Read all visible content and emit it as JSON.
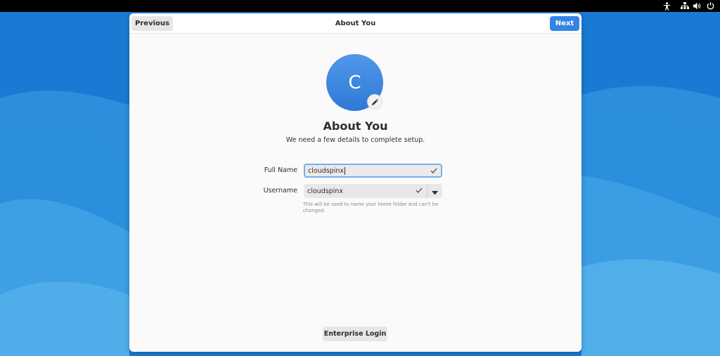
{
  "topbar": {
    "icons": [
      "accessibility-icon",
      "network-wired-icon",
      "volume-icon",
      "power-icon"
    ]
  },
  "window": {
    "title": "About You",
    "previous_label": "Previous",
    "next_label": "Next"
  },
  "avatar": {
    "initial": "C",
    "edit_icon": "pencil-icon"
  },
  "page": {
    "title": "About You",
    "subtitle": "We need a few details to complete setup."
  },
  "form": {
    "full_name_label": "Full Name",
    "full_name_value": "cloudspinx",
    "username_label": "Username",
    "username_value": "cloudspinx",
    "username_hint": "This will be used to name your home folder and can't be changed."
  },
  "enterprise_login_label": "Enterprise Login",
  "colors": {
    "accent": "#3584e4",
    "wallpaper": "#1c7fd4"
  }
}
